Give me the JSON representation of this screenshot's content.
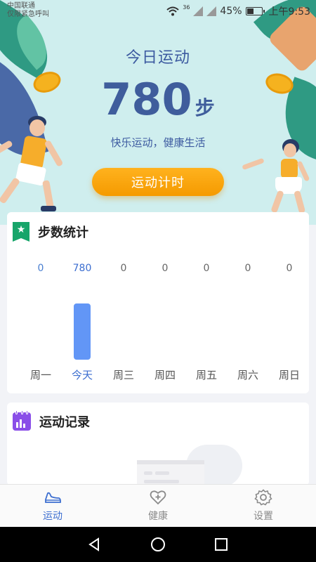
{
  "status_bar": {
    "carrier_line1": "中国联通",
    "carrier_line2": "仅限紧急呼叫",
    "signal_label": "36",
    "battery": "45%",
    "time": "上午9:53"
  },
  "hero": {
    "title": "今日运动",
    "steps": "780",
    "steps_unit": "步",
    "slogan": "快乐运动，健康生活",
    "timer_button": "运动计时"
  },
  "steps_card": {
    "title": "步数统计",
    "icon": "star-bookmark-icon",
    "days": [
      {
        "label": "周一",
        "value": "0",
        "steps": 0,
        "highlight": false
      },
      {
        "label": "今天",
        "value": "780",
        "steps": 780,
        "highlight": true
      },
      {
        "label": "周三",
        "value": "0",
        "steps": 0,
        "highlight": false
      },
      {
        "label": "周四",
        "value": "0",
        "steps": 0,
        "highlight": false
      },
      {
        "label": "周五",
        "value": "0",
        "steps": 0,
        "highlight": false
      },
      {
        "label": "周六",
        "value": "0",
        "steps": 0,
        "highlight": false
      },
      {
        "label": "周日",
        "value": "0",
        "steps": 0,
        "highlight": false
      }
    ],
    "bar_color": "#6296f6",
    "highlight_color": "#3c6ed0"
  },
  "records_card": {
    "title": "运动记录",
    "icon": "calendar-chart-icon"
  },
  "bottom_nav": [
    {
      "label": "运动",
      "icon": "sneaker-icon",
      "active": true
    },
    {
      "label": "健康",
      "icon": "heart-plus-icon",
      "active": false
    },
    {
      "label": "设置",
      "icon": "gear-icon",
      "active": false
    }
  ],
  "colors": {
    "accent": "#3c6ed0",
    "hero_bg": "#cfeeee",
    "timer_button": "#f7a30a"
  }
}
